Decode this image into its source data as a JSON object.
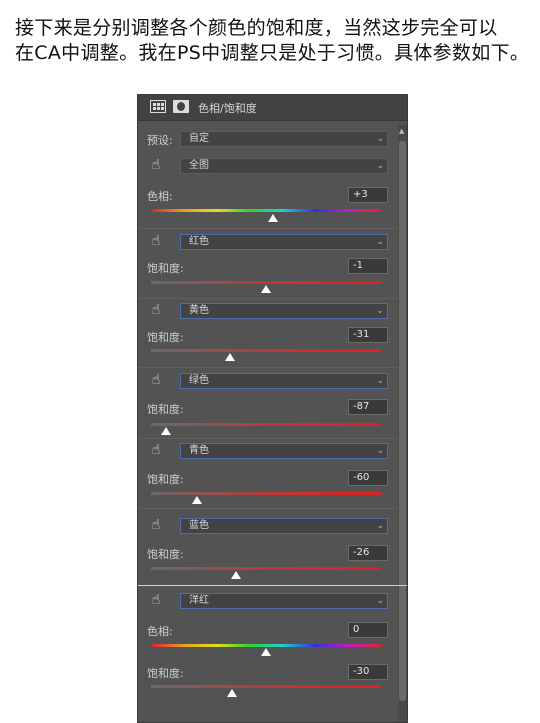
{
  "caption": {
    "line1": "接下来是分别调整各个颜色的饱和度，当然这步完全可以",
    "line2": "在CA中调整。我在PS中调整只是处于习惯。具体参数如下。"
  },
  "panel": {
    "title": "色相/饱和度",
    "preset_label": "预设:",
    "preset_value": "自定",
    "master": {
      "channel": "全图",
      "hue_label": "色相:",
      "hue_value": "+3",
      "hue_position": 0.53
    },
    "channels": [
      {
        "channel": "红色",
        "sat_label": "饱和度:",
        "sat_value": "-1",
        "sat_position": 0.5
      },
      {
        "channel": "黄色",
        "sat_label": "饱和度:",
        "sat_value": "-31",
        "sat_position": 0.345
      },
      {
        "channel": "绿色",
        "sat_label": "饱和度:",
        "sat_value": "-87",
        "sat_position": 0.065
      },
      {
        "channel": "青色",
        "sat_label": "饱和度:",
        "sat_value": "-60",
        "sat_position": 0.2
      },
      {
        "channel": "蓝色",
        "sat_label": "饱和度:",
        "sat_value": "-26",
        "sat_position": 0.37
      }
    ],
    "magenta": {
      "channel": "洋红",
      "hue_label": "色相:",
      "hue_value": "0",
      "hue_position": 0.5,
      "sat_label": "饱和度:",
      "sat_value": "-30",
      "sat_position": 0.35
    }
  }
}
